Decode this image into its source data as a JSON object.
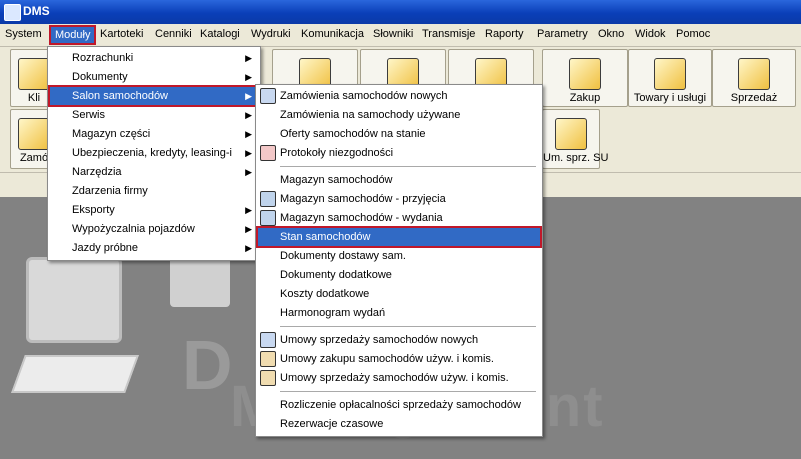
{
  "window": {
    "title": "DMS",
    "app_icon": "dms-app-icon"
  },
  "menubar": {
    "items": [
      "System",
      "Moduły",
      "Kartoteki",
      "Cenniki",
      "Katalogi",
      "Wydruki",
      "Komunikacja",
      "Słowniki",
      "Transmisje",
      "Raporty",
      "Parametry",
      "Okno",
      "Widok",
      "Pomoc"
    ],
    "active": "Moduły"
  },
  "toolbar": {
    "row1": [
      "Kli",
      "",
      "",
      "",
      "Zakup",
      "Towary i usługi",
      "Sprzedaż"
    ],
    "row2": [
      "Zamó",
      "Um. sprz. SU"
    ]
  },
  "modules_menu": {
    "items": [
      "Rozrachunki",
      "Dokumenty",
      "Salon samochodów",
      "Serwis",
      "Magazyn części",
      "Ubezpieczenia, kredyty, leasing-i",
      "Narzędzia",
      "Zdarzenia firmy",
      "Eksporty",
      "Wypożyczalnia pojazdów",
      "Jazdy próbne"
    ],
    "highlighted": "Salon samochodów"
  },
  "salon_menu": {
    "items": [
      "Zamówienia samochodów nowych",
      "Zamówienia na samochody używane",
      "Oferty samochodów na stanie",
      "Protokoły niezgodności",
      "Magazyn samochodów",
      "Magazyn samochodów - przyjęcia",
      "Magazyn samochodów - wydania",
      "Stan samochodów",
      "Dokumenty dostawy sam.",
      "Dokumenty dodatkowe",
      "Koszty dodatkowe",
      "Harmonogram wydań",
      "Umowy sprzedaży samochodów nowych",
      "Umowy zakupu samochodów używ. i komis.",
      "Umowy sprzedaży samochodów używ. i komis.",
      "Rozliczenie opłacalności sprzedaży samochodów",
      "Rezerwacje czasowe"
    ],
    "highlighted": "Stan samochodów"
  },
  "background": {
    "logo_letter": "D",
    "logo_word": "Management"
  },
  "colors": {
    "highlight": "#316ac5",
    "annotation": "#c0182a",
    "titlebar": "#0a3fb8"
  }
}
